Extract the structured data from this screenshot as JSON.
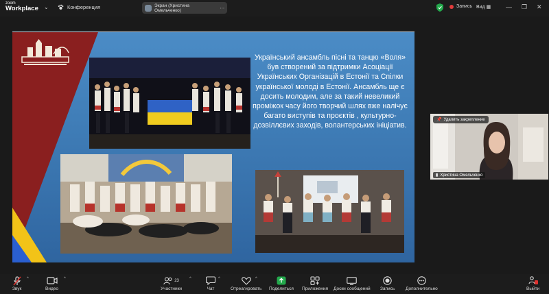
{
  "app": {
    "logo_small": "zoom",
    "logo_big": "Workplace"
  },
  "topbar": {
    "conference_label": "Конференция",
    "share_pill_label": "Экран (Христина Омельченко)",
    "record_label": "Запись",
    "view_label": "Вид"
  },
  "slide": {
    "text": "Український ансамбль пісні та танцю «Воля» був створений за підтримки Асоціації Українських Організацій в Естонії та Спілки української молоді в Естонії. Ансамбль ще є досить молодим, але за такий невеликий проміжок часу його творчий шлях вже налічує багато виступів та проєктів , культурно-дозвіллєвих заходів, волантерських ініціатив."
  },
  "participant": {
    "unpin_label": "Удалить закрепление",
    "name": "Христина Омельченко"
  },
  "toolbar": {
    "audio": "Звук",
    "video": "Видео",
    "participants": "Участники",
    "participants_count": "23",
    "chat": "Чат",
    "react": "Отреагировать",
    "share": "Поделиться",
    "apps": "Приложения",
    "whiteboards": "Доски сообщений",
    "record": "Запись",
    "more": "Дополнительно",
    "leave": "Выйти"
  },
  "colors": {
    "share_green": "#23a94c",
    "leave_red": "#e0322f",
    "slide_blue": "#3e7bb5",
    "slide_red": "#8a1f1f",
    "accent_yellow": "#f2c318"
  }
}
